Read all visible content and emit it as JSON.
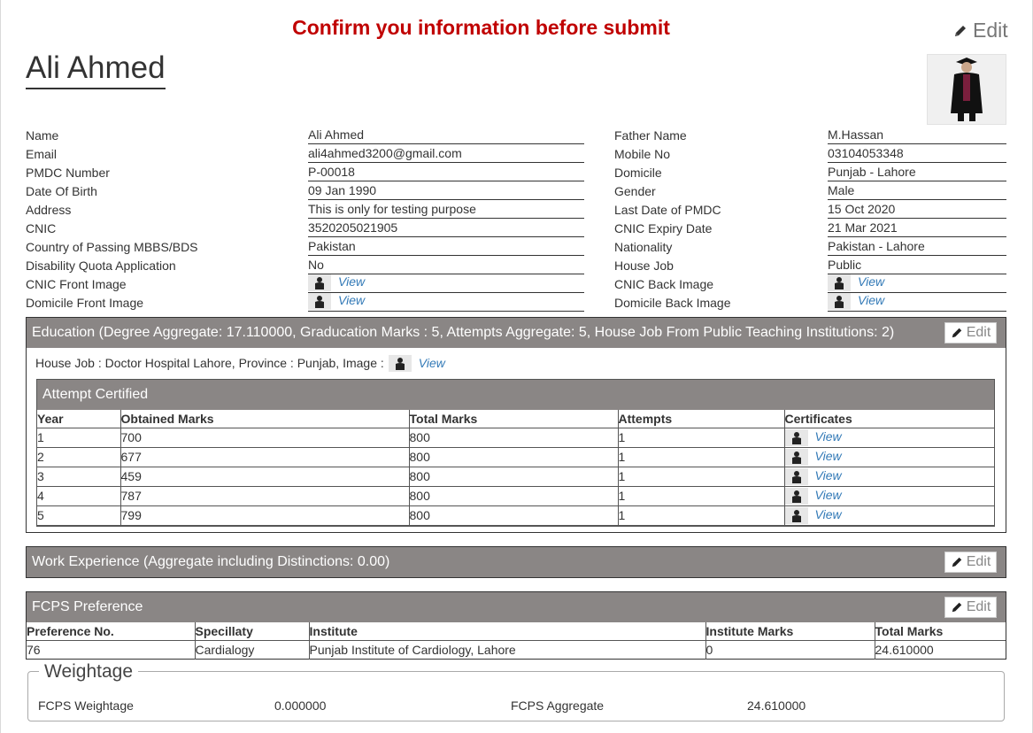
{
  "banner": "Confirm you information before submit",
  "top_edit": "Edit",
  "name": "Ali Ahmed",
  "personal": {
    "left": [
      {
        "label": "Name",
        "value": "Ali Ahmed"
      },
      {
        "label": "Email",
        "value": "ali4ahmed3200@gmail.com"
      },
      {
        "label": "PMDC Number",
        "value": "P-00018"
      },
      {
        "label": "Date Of Birth",
        "value": "09 Jan 1990"
      },
      {
        "label": "Address",
        "value": "This is only for testing purpose"
      },
      {
        "label": "CNIC",
        "value": "3520205021905"
      },
      {
        "label": "Country of Passing MBBS/BDS",
        "value": "Pakistan"
      },
      {
        "label": "Disability Quota Application",
        "value": "No"
      },
      {
        "label": "CNIC Front Image",
        "value": "View"
      },
      {
        "label": "Domicile Front Image",
        "value": "View"
      }
    ],
    "right": [
      {
        "label": "Father Name",
        "value": "M.Hassan"
      },
      {
        "label": "Mobile No",
        "value": "03104053348"
      },
      {
        "label": "Domicile",
        "value": "Punjab - Lahore"
      },
      {
        "label": "Gender",
        "value": "Male"
      },
      {
        "label": "Last Date of PMDC",
        "value": "15 Oct 2020"
      },
      {
        "label": "CNIC Expiry Date",
        "value": "21 Mar 2021"
      },
      {
        "label": "Nationality",
        "value": "Pakistan - Lahore"
      },
      {
        "label": "House Job",
        "value": "Public"
      },
      {
        "label": "CNIC Back Image",
        "value": "View"
      },
      {
        "label": "Domicile Back Image",
        "value": "View"
      }
    ]
  },
  "education": {
    "title": "Education (Degree Aggregate: 17.110000, Graducation Marks : 5, Attempts Aggregate: 5, House Job From Public Teaching Institutions: 2)",
    "edit": "Edit",
    "house_job_text": "House Job : Doctor Hospital Lahore, Province : Punjab, Image :",
    "house_job_view": "View",
    "attempt_title": "Attempt Certified",
    "headers": [
      "Year",
      "Obtained Marks",
      "Total Marks",
      "Attempts",
      "Certificates"
    ],
    "rows": [
      [
        "1",
        "700",
        "800",
        "1",
        "View"
      ],
      [
        "2",
        "677",
        "800",
        "1",
        "View"
      ],
      [
        "3",
        "459",
        "800",
        "1",
        "View"
      ],
      [
        "4",
        "787",
        "800",
        "1",
        "View"
      ],
      [
        "5",
        "799",
        "800",
        "1",
        "View"
      ]
    ]
  },
  "work": {
    "title": "Work Experience (Aggregate including Distinctions: 0.00)",
    "edit": "Edit"
  },
  "fcps": {
    "title": "FCPS Preference",
    "edit": "Edit",
    "headers": [
      "Preference No.",
      "Specillaty",
      "Institute",
      "Institute Marks",
      "Total Marks"
    ],
    "rows": [
      [
        "76",
        "Cardialogy",
        "Punjab Institute of Cardiology, Lahore",
        "0",
        "24.610000"
      ]
    ]
  },
  "weightage": {
    "legend": "Weightage",
    "fcps_weightage_label": "FCPS Weightage",
    "fcps_weightage_value": "0.000000",
    "fcps_aggregate_label": "FCPS Aggregate",
    "fcps_aggregate_value": "24.610000"
  },
  "colors": {
    "banner": "#c00000",
    "panel_head": "#8a8685",
    "link": "#337ab7"
  },
  "icons": {
    "edit": "pencil-icon",
    "image": "graduate-thumbnail-icon"
  }
}
